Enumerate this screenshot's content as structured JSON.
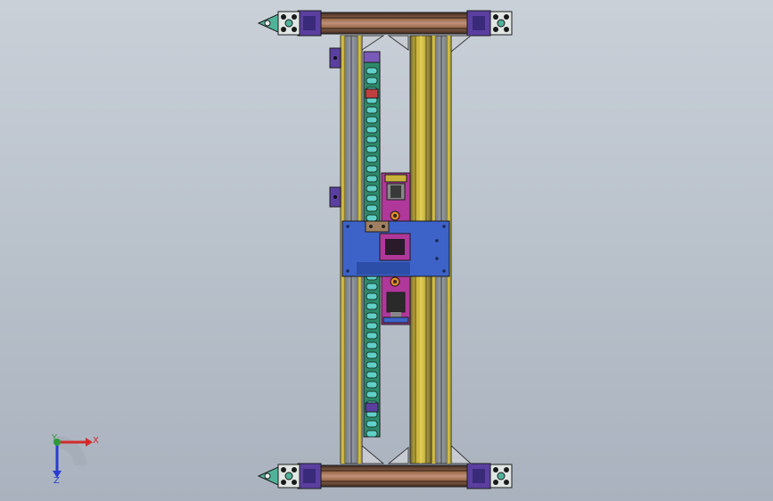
{
  "viewport": {
    "background_top": "#c9d0d8",
    "background_bottom": "#a9b2be"
  },
  "model": {
    "colors": {
      "rail_yellow": "#c8b23a",
      "rail_dark": "#6d6530",
      "rail_grey": "#8e949a",
      "beam_brown": "#8a5a3c",
      "carriage_blue": "#3d63c9",
      "bracket_purple": "#5b3fa0",
      "cutout_magenta": "#b0389a",
      "chain_green": "#2d8a6a",
      "chain_cyan": "#5fd0c8",
      "connector_teal": "#4fb39a"
    }
  },
  "triad": {
    "x_label": "X",
    "y_label": "Y",
    "z_label": "Z",
    "x_color": "#d42a2a",
    "y_color": "#2a9a3a",
    "z_color": "#2a3ad4"
  }
}
